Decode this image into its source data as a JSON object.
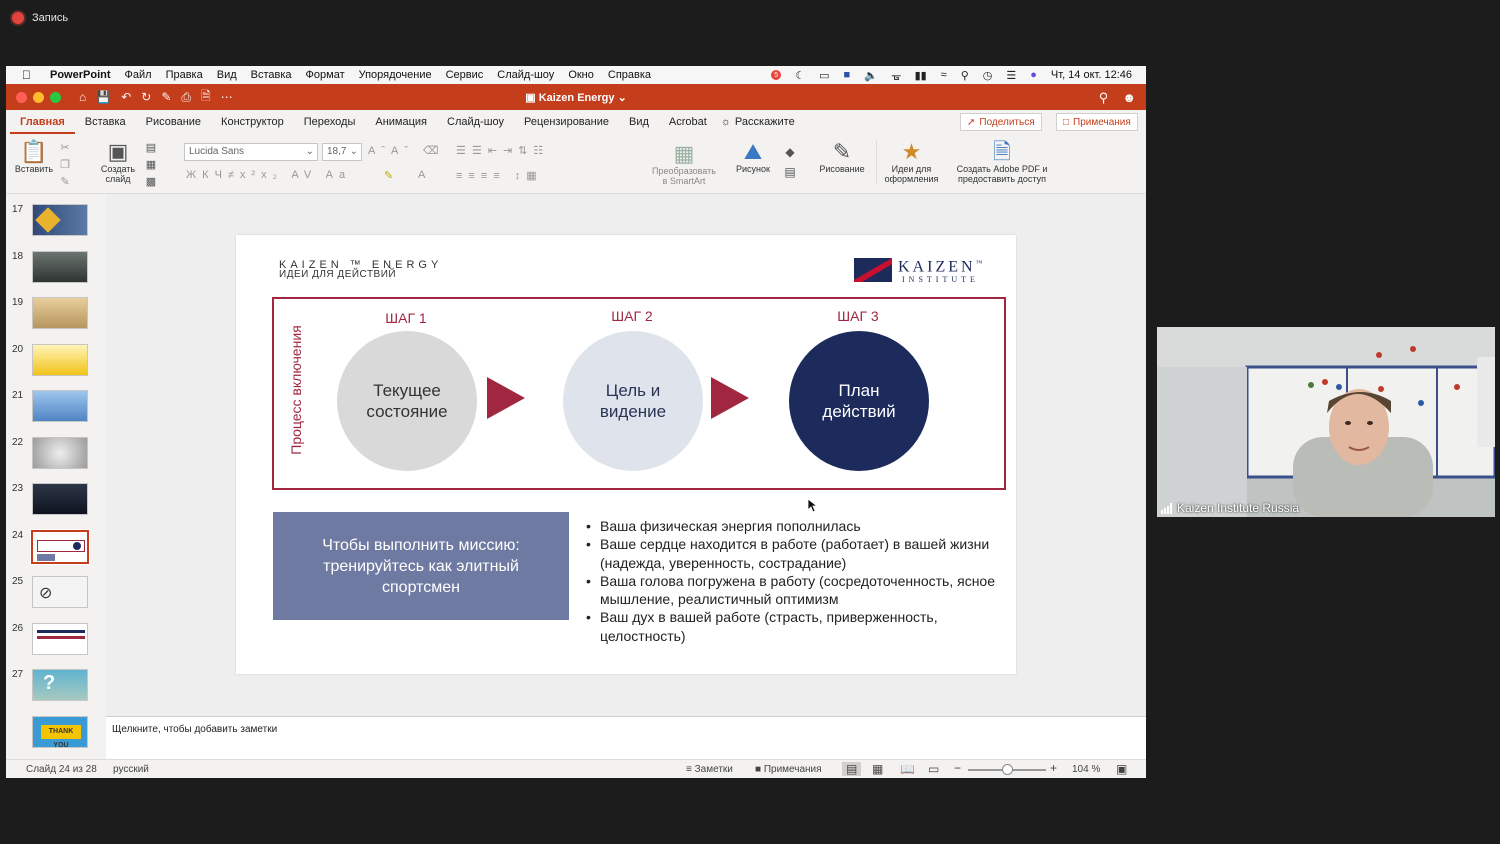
{
  "recording": {
    "label": "Запись"
  },
  "menubar": {
    "app_name": "PowerPoint",
    "items": [
      "Файл",
      "Правка",
      "Вид",
      "Вставка",
      "Формат",
      "Упорядочение",
      "Сервис",
      "Слайд-шоу",
      "Окно",
      "Справка"
    ],
    "notification_count": "5",
    "datetime": "Чт, 14 окт.  12:46"
  },
  "titlebar": {
    "title": "Kaizen Energy"
  },
  "tabs": {
    "items": [
      "Главная",
      "Вставка",
      "Рисование",
      "Конструктор",
      "Переходы",
      "Анимация",
      "Слайд-шоу",
      "Рецензирование",
      "Вид",
      "Acrobat"
    ],
    "active": "Главная",
    "tell_me": "Расскажите",
    "share": "Поделиться",
    "comments": "Примечания"
  },
  "ribbon": {
    "paste": "Вставить",
    "new_slide_1": "Создать",
    "new_slide_2": "слайд",
    "font_name": "Lucida Sans",
    "font_size": "18,7",
    "smartart_1": "Преобразовать",
    "smartart_2": "в SmartArt",
    "picture": "Рисунок",
    "drawing": "Рисование",
    "designer_1": "Идеи для",
    "designer_2": "оформления",
    "adobe_1": "Создать Adobe PDF и",
    "adobe_2": "предоставить доступ"
  },
  "thumbnails": {
    "numbers": [
      "17",
      "18",
      "19",
      "20",
      "21",
      "22",
      "23",
      "24",
      "25",
      "26",
      "27",
      "28"
    ],
    "selected": "24",
    "thank_you": "THANK YOU"
  },
  "slide": {
    "brand_line1": "KAIZEN ™ ENERGY",
    "brand_line2": "ИДЕИ ДЛЯ ДЕЙСТВИЙ",
    "logo_line1": "KAIZEN",
    "logo_tm": "™",
    "logo_line2": "INSTITUTE",
    "vertical_label": "Процесс включения",
    "steps": [
      {
        "label": "ШАГ 1",
        "text_1": "Текущее",
        "text_2": "состояние"
      },
      {
        "label": "ШАГ 2",
        "text_1": "Цель и",
        "text_2": "видение"
      },
      {
        "label": "ШАГ 3",
        "text_1": "План",
        "text_2": "действий"
      }
    ],
    "mission": "Чтобы выполнить миссию: тренируйтесь как элитный спортсмен",
    "bullets": [
      "Ваша физическая энергия пополнилась",
      "Ваше сердце находится в работе (работает) в вашей жизни (надежда, уверенность, сострадание)",
      "Ваша голова погружена в работу (сосредоточенность, ясное мышление, реалистичный оптимизм",
      "Ваш дух в вашей работе (страсть, приверженность, целостность)"
    ]
  },
  "notes": {
    "placeholder": "Щелкните, чтобы добавить заметки"
  },
  "status": {
    "slide_info": "Слайд 24 из 28",
    "language": "русский",
    "notes": "Заметки",
    "comments": "Примечания",
    "zoom": "104 %",
    "zoom_level": 0.55
  },
  "webcam": {
    "name": "Kaizen Institute Russia"
  },
  "colors": {
    "accent": "#c43e1c",
    "slide_red": "#a0273f",
    "slide_navy": "#1d2a5c",
    "mission_box": "#6e7aa1"
  }
}
